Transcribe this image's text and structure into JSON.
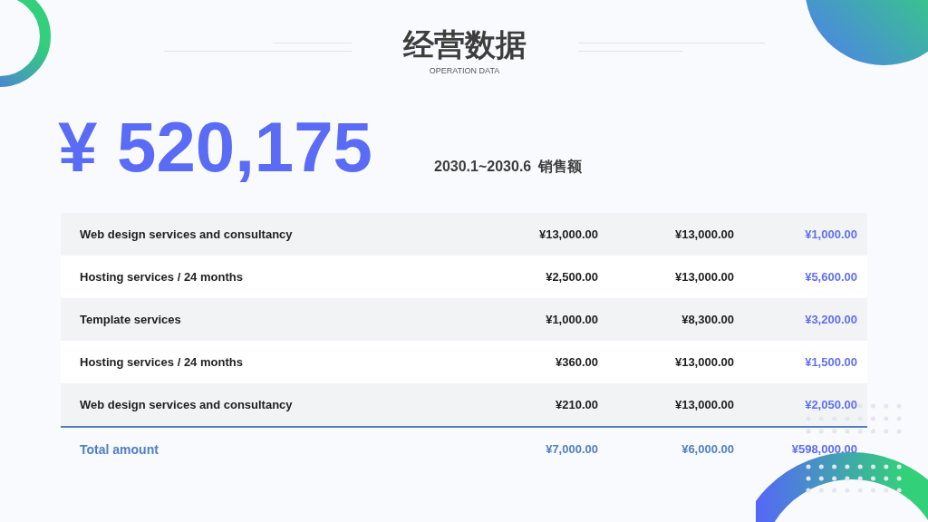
{
  "header": {
    "title": "经营数据",
    "subtitle": "OPERATION DATA"
  },
  "summary": {
    "amount": "¥ 520,175",
    "period": "2030.1~2030.6",
    "label": "销售额"
  },
  "table": {
    "rows": [
      {
        "label": "Web design services and consultancy",
        "values": [
          "¥13,000.00",
          "¥13,000.00",
          "¥1,000.00"
        ]
      },
      {
        "label": "Hosting services / 24 months",
        "values": [
          "¥2,500.00",
          "¥13,000.00",
          "¥5,600.00"
        ]
      },
      {
        "label": "Template services",
        "values": [
          "¥1,000.00",
          "¥8,300.00",
          "¥3,200.00"
        ]
      },
      {
        "label": "Hosting services / 24 months",
        "values": [
          "¥360.00",
          "¥13,000.00",
          "¥1,500.00"
        ]
      },
      {
        "label": "Web design services and consultancy",
        "values": [
          "¥210.00",
          "¥13,000.00",
          "¥2,050.00"
        ]
      }
    ],
    "total": {
      "label": "Total amount",
      "values": [
        "¥7,000.00",
        "¥6,000.00",
        "¥598,000.00"
      ]
    }
  }
}
